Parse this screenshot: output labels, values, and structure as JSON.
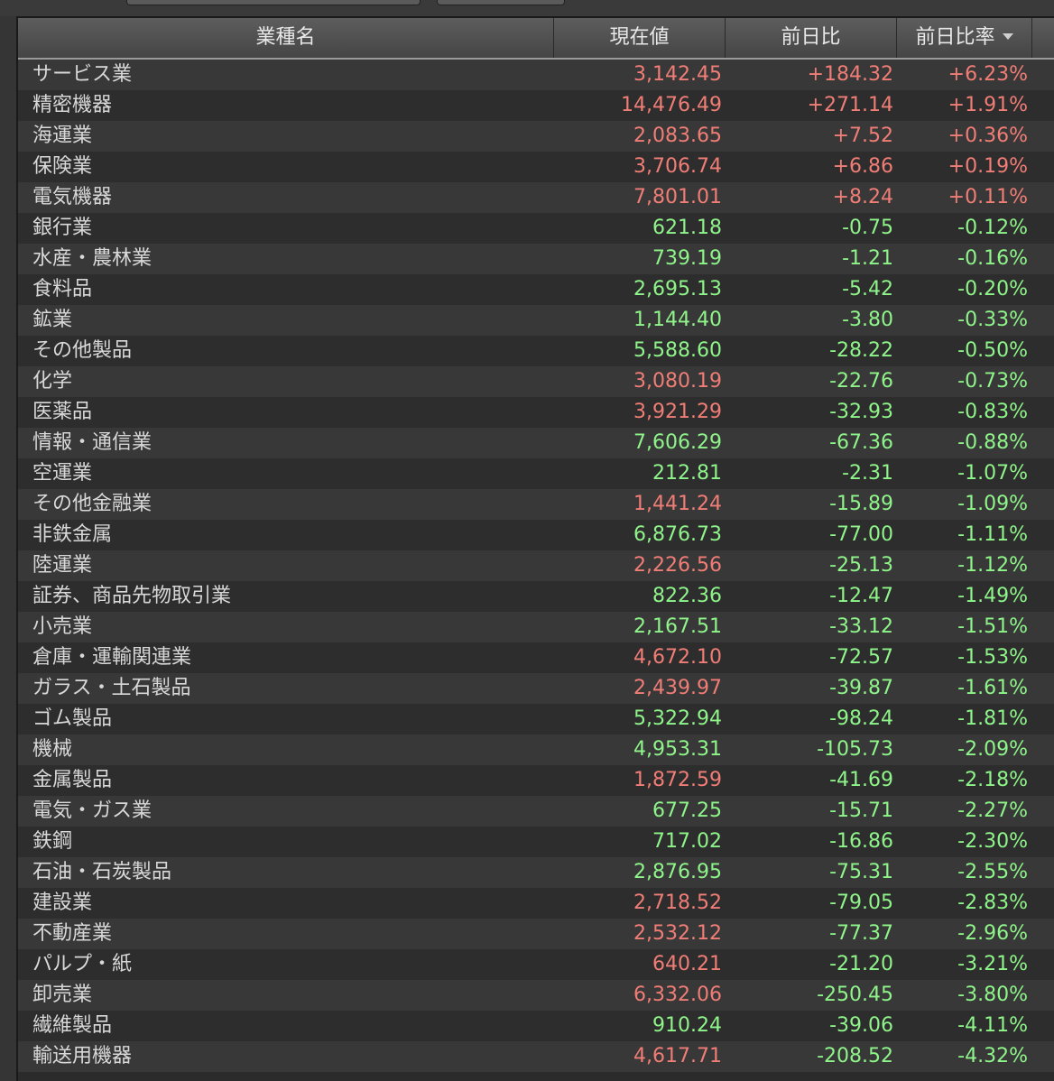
{
  "colors": {
    "up": "#f07d76",
    "down": "#8ff58a",
    "text": "#d8d8d8",
    "background": "#2b2b2b"
  },
  "table": {
    "headers": {
      "name": "業種名",
      "price": "現在値",
      "change": "前日比",
      "change_pct": "前日比率"
    },
    "sort_indicator": "chevron-down-icon",
    "rows": [
      {
        "name": "サービス業",
        "price": "3,142.45",
        "price_dir": "up",
        "change": "+184.32",
        "change_dir": "up",
        "pct": "+6.23%",
        "pct_dir": "up"
      },
      {
        "name": "精密機器",
        "price": "14,476.49",
        "price_dir": "up",
        "change": "+271.14",
        "change_dir": "up",
        "pct": "+1.91%",
        "pct_dir": "up"
      },
      {
        "name": "海運業",
        "price": "2,083.65",
        "price_dir": "up",
        "change": "+7.52",
        "change_dir": "up",
        "pct": "+0.36%",
        "pct_dir": "up"
      },
      {
        "name": "保険業",
        "price": "3,706.74",
        "price_dir": "up",
        "change": "+6.86",
        "change_dir": "up",
        "pct": "+0.19%",
        "pct_dir": "up"
      },
      {
        "name": "電気機器",
        "price": "7,801.01",
        "price_dir": "up",
        "change": "+8.24",
        "change_dir": "up",
        "pct": "+0.11%",
        "pct_dir": "up"
      },
      {
        "name": "銀行業",
        "price": "621.18",
        "price_dir": "down",
        "change": "-0.75",
        "change_dir": "down",
        "pct": "-0.12%",
        "pct_dir": "down"
      },
      {
        "name": "水産・農林業",
        "price": "739.19",
        "price_dir": "down",
        "change": "-1.21",
        "change_dir": "down",
        "pct": "-0.16%",
        "pct_dir": "down"
      },
      {
        "name": "食料品",
        "price": "2,695.13",
        "price_dir": "down",
        "change": "-5.42",
        "change_dir": "down",
        "pct": "-0.20%",
        "pct_dir": "down"
      },
      {
        "name": "鉱業",
        "price": "1,144.40",
        "price_dir": "down",
        "change": "-3.80",
        "change_dir": "down",
        "pct": "-0.33%",
        "pct_dir": "down"
      },
      {
        "name": "その他製品",
        "price": "5,588.60",
        "price_dir": "down",
        "change": "-28.22",
        "change_dir": "down",
        "pct": "-0.50%",
        "pct_dir": "down"
      },
      {
        "name": "化学",
        "price": "3,080.19",
        "price_dir": "up",
        "change": "-22.76",
        "change_dir": "down",
        "pct": "-0.73%",
        "pct_dir": "down"
      },
      {
        "name": "医薬品",
        "price": "3,921.29",
        "price_dir": "up",
        "change": "-32.93",
        "change_dir": "down",
        "pct": "-0.83%",
        "pct_dir": "down"
      },
      {
        "name": "情報・通信業",
        "price": "7,606.29",
        "price_dir": "down",
        "change": "-67.36",
        "change_dir": "down",
        "pct": "-0.88%",
        "pct_dir": "down"
      },
      {
        "name": "空運業",
        "price": "212.81",
        "price_dir": "down",
        "change": "-2.31",
        "change_dir": "down",
        "pct": "-1.07%",
        "pct_dir": "down"
      },
      {
        "name": "その他金融業",
        "price": "1,441.24",
        "price_dir": "up",
        "change": "-15.89",
        "change_dir": "down",
        "pct": "-1.09%",
        "pct_dir": "down"
      },
      {
        "name": "非鉄金属",
        "price": "6,876.73",
        "price_dir": "down",
        "change": "-77.00",
        "change_dir": "down",
        "pct": "-1.11%",
        "pct_dir": "down"
      },
      {
        "name": "陸運業",
        "price": "2,226.56",
        "price_dir": "up",
        "change": "-25.13",
        "change_dir": "down",
        "pct": "-1.12%",
        "pct_dir": "down"
      },
      {
        "name": "証券、商品先物取引業",
        "price": "822.36",
        "price_dir": "down",
        "change": "-12.47",
        "change_dir": "down",
        "pct": "-1.49%",
        "pct_dir": "down"
      },
      {
        "name": "小売業",
        "price": "2,167.51",
        "price_dir": "down",
        "change": "-33.12",
        "change_dir": "down",
        "pct": "-1.51%",
        "pct_dir": "down"
      },
      {
        "name": "倉庫・運輸関連業",
        "price": "4,672.10",
        "price_dir": "up",
        "change": "-72.57",
        "change_dir": "down",
        "pct": "-1.53%",
        "pct_dir": "down"
      },
      {
        "name": "ガラス・土石製品",
        "price": "2,439.97",
        "price_dir": "up",
        "change": "-39.87",
        "change_dir": "down",
        "pct": "-1.61%",
        "pct_dir": "down"
      },
      {
        "name": "ゴム製品",
        "price": "5,322.94",
        "price_dir": "down",
        "change": "-98.24",
        "change_dir": "down",
        "pct": "-1.81%",
        "pct_dir": "down"
      },
      {
        "name": "機械",
        "price": "4,953.31",
        "price_dir": "down",
        "change": "-105.73",
        "change_dir": "down",
        "pct": "-2.09%",
        "pct_dir": "down"
      },
      {
        "name": "金属製品",
        "price": "1,872.59",
        "price_dir": "up",
        "change": "-41.69",
        "change_dir": "down",
        "pct": "-2.18%",
        "pct_dir": "down"
      },
      {
        "name": "電気・ガス業",
        "price": "677.25",
        "price_dir": "down",
        "change": "-15.71",
        "change_dir": "down",
        "pct": "-2.27%",
        "pct_dir": "down"
      },
      {
        "name": "鉄鋼",
        "price": "717.02",
        "price_dir": "down",
        "change": "-16.86",
        "change_dir": "down",
        "pct": "-2.30%",
        "pct_dir": "down"
      },
      {
        "name": "石油・石炭製品",
        "price": "2,876.95",
        "price_dir": "down",
        "change": "-75.31",
        "change_dir": "down",
        "pct": "-2.55%",
        "pct_dir": "down"
      },
      {
        "name": "建設業",
        "price": "2,718.52",
        "price_dir": "up",
        "change": "-79.05",
        "change_dir": "down",
        "pct": "-2.83%",
        "pct_dir": "down"
      },
      {
        "name": "不動産業",
        "price": "2,532.12",
        "price_dir": "up",
        "change": "-77.37",
        "change_dir": "down",
        "pct": "-2.96%",
        "pct_dir": "down"
      },
      {
        "name": "パルプ・紙",
        "price": "640.21",
        "price_dir": "up",
        "change": "-21.20",
        "change_dir": "down",
        "pct": "-3.21%",
        "pct_dir": "down"
      },
      {
        "name": "卸売業",
        "price": "6,332.06",
        "price_dir": "up",
        "change": "-250.45",
        "change_dir": "down",
        "pct": "-3.80%",
        "pct_dir": "down"
      },
      {
        "name": "繊維製品",
        "price": "910.24",
        "price_dir": "down",
        "change": "-39.06",
        "change_dir": "down",
        "pct": "-4.11%",
        "pct_dir": "down"
      },
      {
        "name": "輸送用機器",
        "price": "4,617.71",
        "price_dir": "up",
        "change": "-208.52",
        "change_dir": "down",
        "pct": "-4.32%",
        "pct_dir": "down"
      }
    ]
  }
}
